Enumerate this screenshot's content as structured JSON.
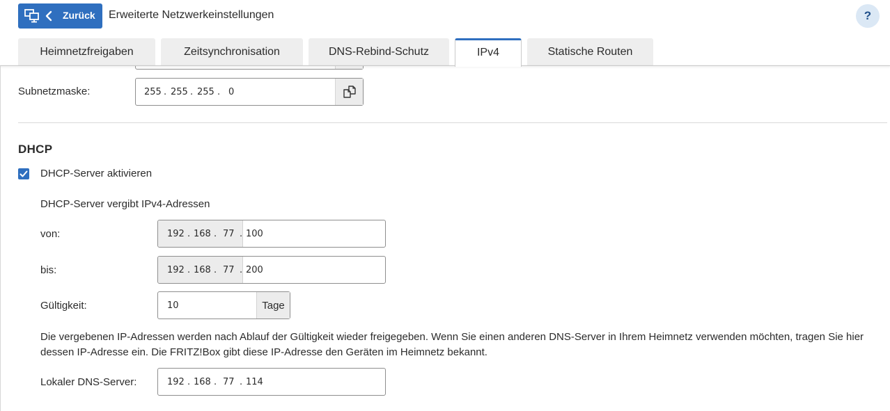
{
  "header": {
    "back_label": "Zurück",
    "title": "Erweiterte Netzwerkeinstellungen",
    "help_label": "?"
  },
  "tabs": [
    {
      "label": "Heimnetzfreigaben",
      "active": false
    },
    {
      "label": "Zeitsynchronisation",
      "active": false
    },
    {
      "label": "DNS-Rebind-Schutz",
      "active": false
    },
    {
      "label": "IPv4",
      "active": true
    },
    {
      "label": "Statische Routen",
      "active": false
    }
  ],
  "network": {
    "subnet_label": "Subnetzmaske:",
    "subnet": [
      "255",
      "255",
      "255",
      "0"
    ]
  },
  "dhcp": {
    "title": "DHCP",
    "enable_label": "DHCP-Server aktivieren",
    "enabled": true,
    "range_heading": "DHCP-Server vergibt IPv4-Adressen",
    "from_label": "von:",
    "from": [
      "192",
      "168",
      "77",
      "100"
    ],
    "to_label": "bis:",
    "to": [
      "192",
      "168",
      "77",
      "200"
    ],
    "validity_label": "Gültigkeit:",
    "validity_value": "10",
    "validity_unit": "Tage",
    "info_text": "Die vergebenen IP-Adressen werden nach Ablauf der Gültigkeit wieder freigegeben. Wenn Sie einen anderen DNS-Server in Ihrem Heimnetz verwenden möchten, tragen Sie hier dessen IP-Adresse ein. Die FRITZ!Box gibt diese IP-Adresse den Geräten im Heimnetz bekannt.",
    "dns_label": "Lokaler DNS-Server:",
    "dns": [
      "192",
      "168",
      "77",
      "114"
    ]
  },
  "colors": {
    "accent": "#2f6fbf",
    "tab_bg": "#eeeeee",
    "field_disabled_bg": "#ececec"
  }
}
